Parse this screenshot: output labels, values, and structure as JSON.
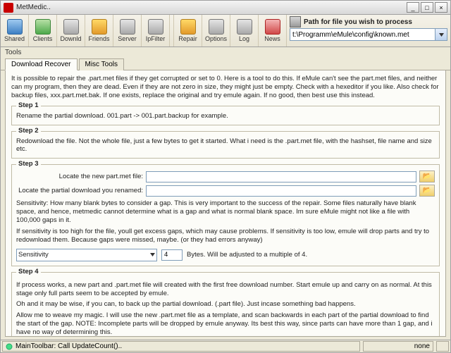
{
  "window": {
    "title": "MetMedic.."
  },
  "toolbar": {
    "items": [
      {
        "label": "Shared",
        "color": "blue"
      },
      {
        "label": "Clients",
        "color": "green"
      },
      {
        "label": "Downld",
        "color": "gray"
      },
      {
        "label": "Friends",
        "color": "orange"
      },
      {
        "label": "Server",
        "color": "gray"
      },
      {
        "label": "IpFilter",
        "color": "gray"
      },
      {
        "label": "Repair",
        "color": "orange"
      },
      {
        "label": "Options",
        "color": "gray"
      },
      {
        "label": "Log",
        "color": "gray"
      },
      {
        "label": "News",
        "color": "red"
      }
    ]
  },
  "path": {
    "label": "Path for file you wish to process",
    "value": "t:\\Programm\\eMule\\config\\known.met"
  },
  "toolsLabel": "Tools",
  "tabs": [
    "Download Recover",
    "Misc Tools"
  ],
  "activeTab": 0,
  "intro": "It is possible to repair the .part.met files if they get corrupted or set to 0. Here is a tool to do this. If eMule can't see the part.met files, and neither can my program, then they are dead. Even if they are not zero in size, they might just be empty. Check with a hexeditor if you like. Also check for backup files, xxx.part.met.bak. If one exists, replace the original and try emule again. If no good, then best use this instead.",
  "step1": {
    "title": "Step 1",
    "text": "Rename the partial download. 001.part -> 001.part.backup for example."
  },
  "step2": {
    "title": "Step 2",
    "text": "Redownload the file. Not the whole file, just a few bytes to get it started. What i need is the .part.met file, with the hashset, file name and size etc."
  },
  "step3": {
    "title": "Step 3",
    "locateNewLbl": "Locate the new part.met file:",
    "locateOldLbl": "Locate the partial download you renamed:",
    "sensText": "Sensitivity: How many blank bytes to consider a gap. This is very important to the success of the repair. Some files naturally have blank space, and hence, metmedic cannot determine what is a gap and what is normal blank space. Im sure eMule might not like a file with 100,000 gaps in it.",
    "warn": "If sensitivity is too high for the file, youll get excess gaps, which may cause problems. If sensitivity is too low, emule will drop parts and try to redownload them. Because gaps were missed, maybe. (or they had errors anyway)",
    "sensLabel": "Sensitivity",
    "bytesVal": "4",
    "bytesTxt": "Bytes. Will be adjusted to a multiple of 4."
  },
  "step4": {
    "title": "Step 4",
    "t1": "If process works, a new part and .part.met file will created with the first free download number. Start emule up and carry on as normal. At this stage only full parts seem to be accepted by emule.",
    "t2": "Oh and it may be wise, if you can, to back up the partial download. (.part file). Just incase something bad happens.",
    "t3": "Allow me to weave my magic. I will use the new .part.met file as a template, and scan backwards in each part of the partial download to find the start of the gap. NOTE: Incomplete parts will be dropped by emule anyway. Its best this way, since parts can have more than 1 gap, and i have no way of determining this."
  },
  "status": {
    "main": "MainToolbar: Call UpdateCount()..",
    "right": "none"
  },
  "inputs": {
    "newMet": "",
    "oldPart": ""
  }
}
